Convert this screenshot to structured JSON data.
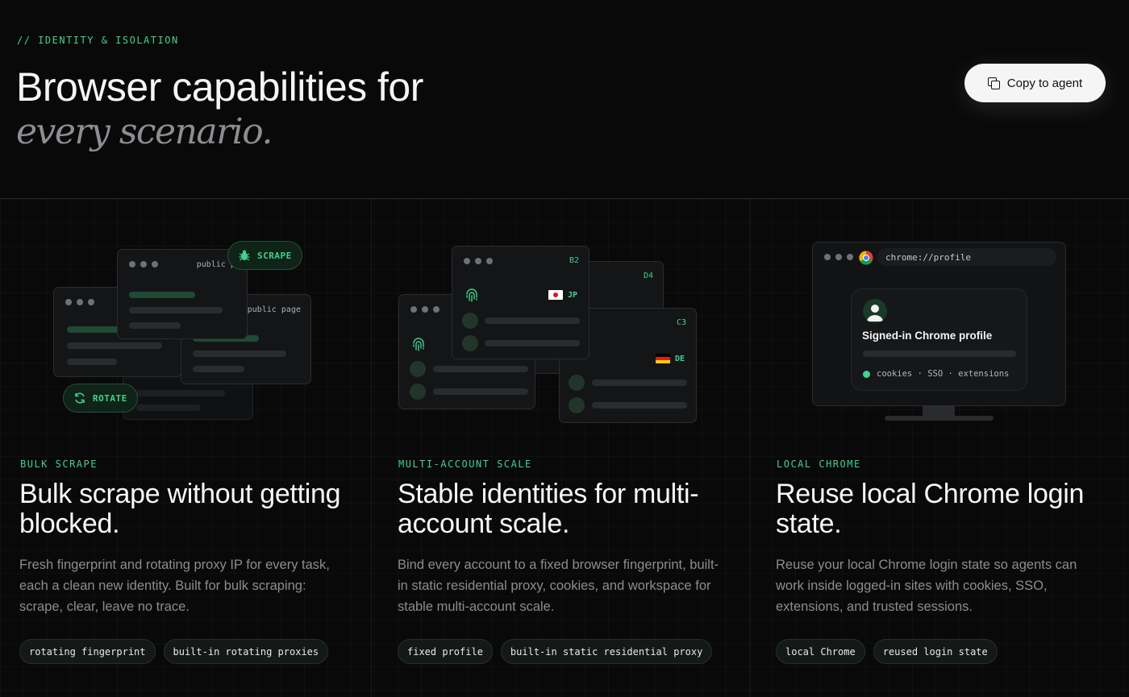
{
  "header": {
    "eyebrow": "// IDENTITY & ISOLATION",
    "title": "Browser capabilities for",
    "subtitle": "every scenario.",
    "copy_button": "Copy to agent"
  },
  "cards": [
    {
      "eyebrow": "BULK SCRAPE",
      "title": "Bulk scrape without getting blocked.",
      "description": "Fresh fingerprint and rotating proxy IP for every task, each a clean new identity. Built for bulk scraping: scrape, clear, leave no trace.",
      "tags": [
        "rotating fingerprint",
        "built-in rotating proxies"
      ],
      "illustration": {
        "window_label": "public page",
        "badge_scrape": "SCRAPE",
        "badge_rotate": "ROTATE"
      }
    },
    {
      "eyebrow": "MULTI-ACCOUNT SCALE",
      "title": "Stable identities for multi-account scale.",
      "description": "Bind every account to a fixed browser fingerprint, built-in static residential proxy, cookies, and workspace for stable multi-account scale.",
      "tags": [
        "fixed profile",
        "built-in static residential proxy"
      ],
      "illustration": {
        "ids": [
          "B2",
          "D4",
          "C3"
        ],
        "countries": [
          "JP",
          "DE"
        ]
      }
    },
    {
      "eyebrow": "LOCAL CHROME",
      "title": "Reuse local Chrome login state.",
      "description": "Reuse your local Chrome login state so agents can work inside logged-in sites with cookies, SSO, extensions, and trusted sessions.",
      "tags": [
        "local Chrome",
        "reused login state"
      ],
      "illustration": {
        "address": "chrome://profile",
        "profile_title": "Signed-in Chrome profile",
        "profile_meta": "cookies · SSO · extensions"
      }
    }
  ],
  "colors": {
    "accent": "#3fd38e",
    "background": "#09090a"
  }
}
